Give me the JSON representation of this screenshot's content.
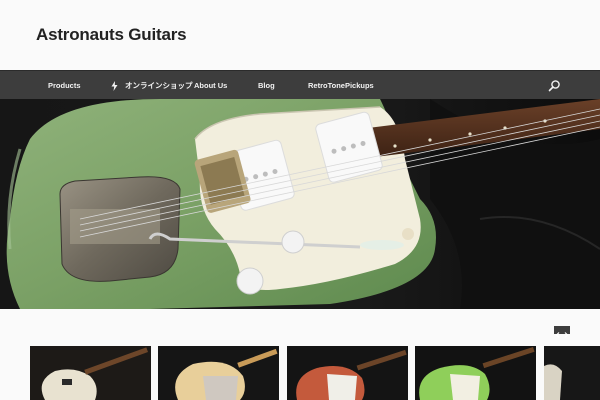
{
  "site": {
    "title": "Astronauts Guitars"
  },
  "nav": {
    "items": [
      {
        "label": "Products"
      },
      {
        "label": "オンラインショップ"
      },
      {
        "label": "About Us"
      },
      {
        "label": "Blog"
      },
      {
        "label": "RetroTonePickups"
      }
    ],
    "search_icon": "search-icon",
    "bolt_icon": "lightning-bolt-icon"
  },
  "colors": {
    "navbar": "#3d3d3d",
    "body_background": "#fafafa",
    "guitar_green": "#7ea56a"
  },
  "carousel": {
    "prev_icon": "chevron-left-icon",
    "next_icon": "chevron-right-icon"
  }
}
